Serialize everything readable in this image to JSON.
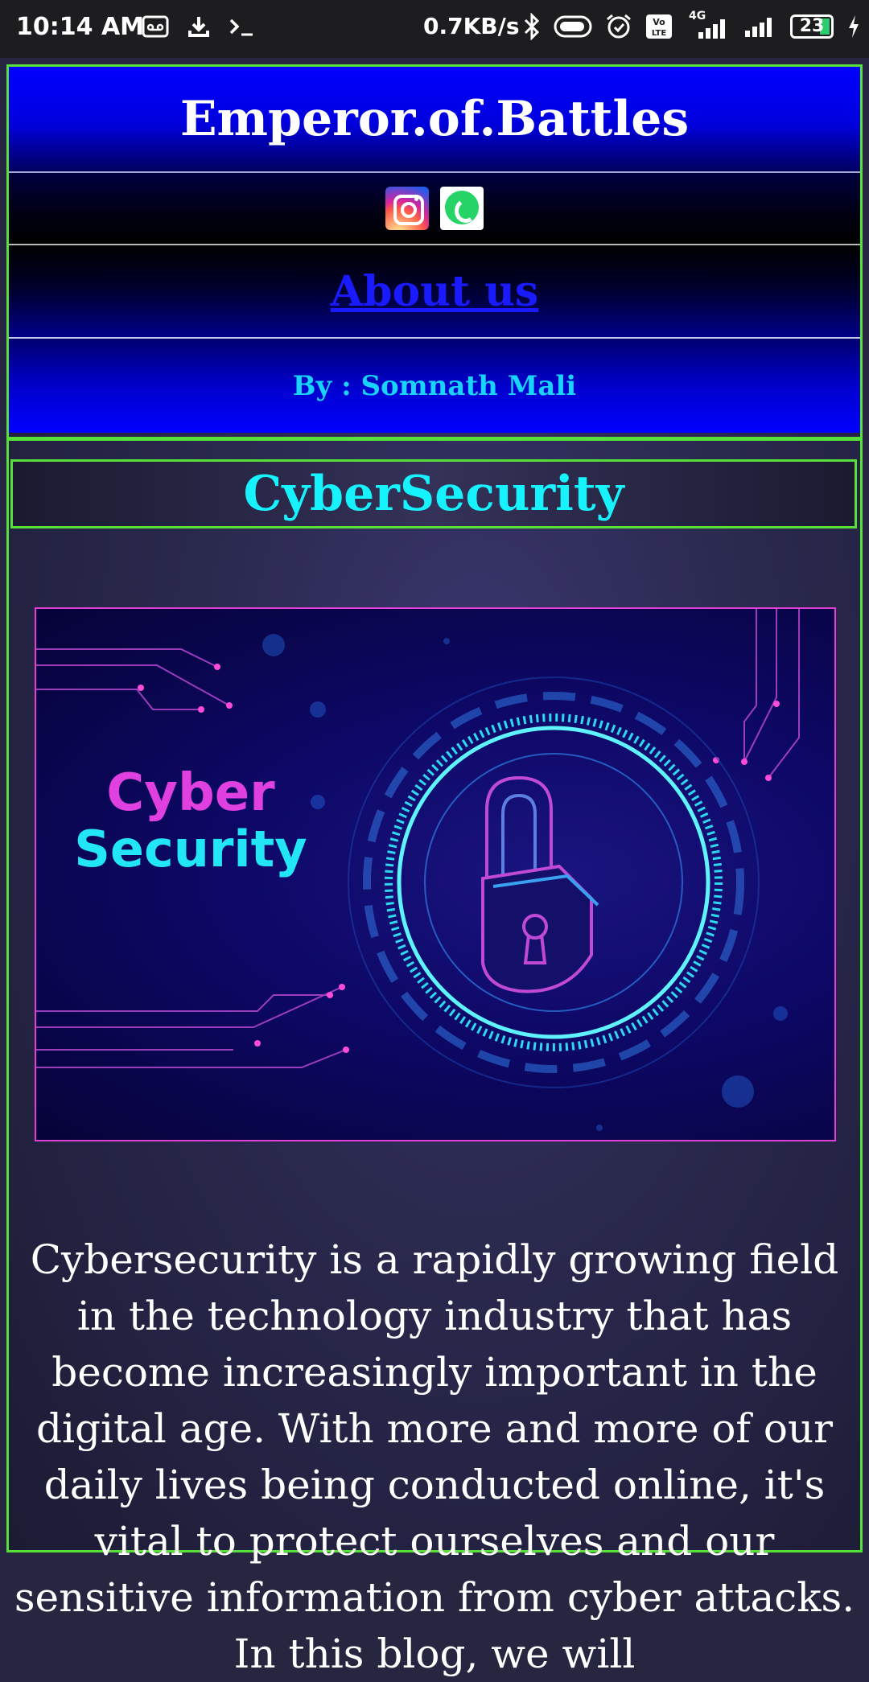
{
  "status_bar": {
    "time": "10:14 AM",
    "net_speed": "0.7KB/s",
    "battery": "23",
    "network": "4G",
    "icons": [
      "voicemail-icon",
      "download-icon",
      "terminal-icon",
      "bluetooth-icon",
      "toggle-icon",
      "alarm-icon",
      "volte-icon",
      "signal-icon",
      "signal-icon",
      "battery-icon",
      "charging-icon"
    ]
  },
  "header": {
    "site_title": "Emperor.of.Battles",
    "social_icons": [
      "instagram-icon",
      "whatsapp-icon"
    ],
    "about_link": "About us",
    "byline": "By : Somnath Mali"
  },
  "section": {
    "title": "CyberSecurity"
  },
  "hero_image": {
    "text_line1": "Cyber",
    "text_line2": "Security",
    "colors": {
      "magenta": "#e040e0",
      "cyan": "#22e6f6",
      "bg": "#0d0866"
    }
  },
  "article": {
    "body": "Cybersecurity is a rapidly growing field in the technology industry that has become increasingly important in the digital age. With more and more of our daily lives being conducted online, it's vital to protect ourselves and our sensitive information from cyber attacks. In this blog, we will"
  },
  "colors": {
    "frame_border": "#58e03a",
    "header_blue": "#0000ff",
    "byline": "#19d3ff",
    "section_title": "#16f3ff",
    "link": "#1a1aff"
  }
}
